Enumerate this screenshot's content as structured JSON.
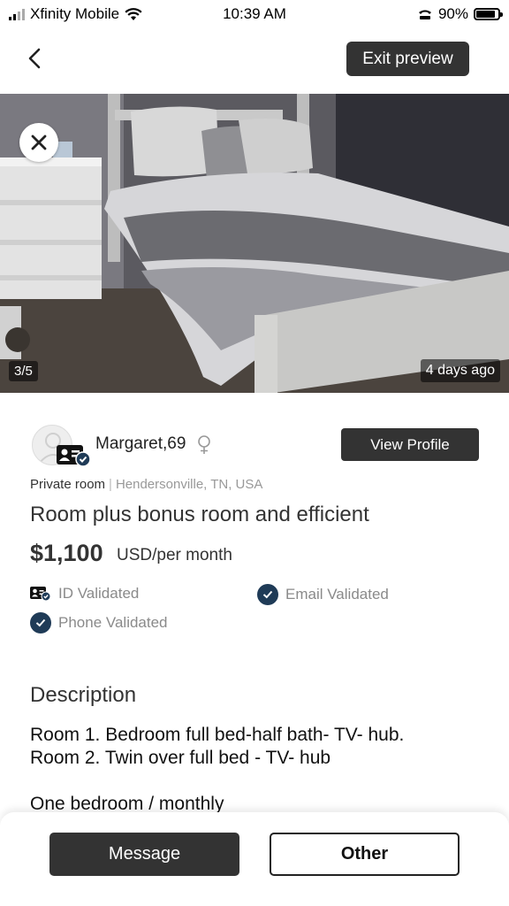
{
  "status_bar": {
    "carrier": "Xfinity Mobile",
    "time": "10:39 AM",
    "battery": "90%"
  },
  "header": {
    "exit_preview_label": "Exit preview"
  },
  "photo": {
    "counter": "3/5",
    "posted": "4 days ago"
  },
  "owner": {
    "name": "Margaret,69",
    "view_profile_label": "View Profile"
  },
  "listing": {
    "room_type": "Private room",
    "location": "Hendersonville, TN, USA",
    "title": "Room plus bonus room and efficient",
    "price": "$1,100",
    "price_unit": "USD/per month"
  },
  "verifications": {
    "id": "ID Validated",
    "email": "Email Validated",
    "phone": "Phone Validated"
  },
  "description": {
    "heading": "Description",
    "text": "Room 1. Bedroom full bed-half bath- TV-  hub.\nRoom 2. Twin over full bed - TV-  hub\n\nOne bedroom / monthly"
  },
  "actions": {
    "message_label": "Message",
    "other_label": "Other"
  },
  "colors": {
    "dark_button": "#333333",
    "verified_check": "#1f3b57"
  }
}
